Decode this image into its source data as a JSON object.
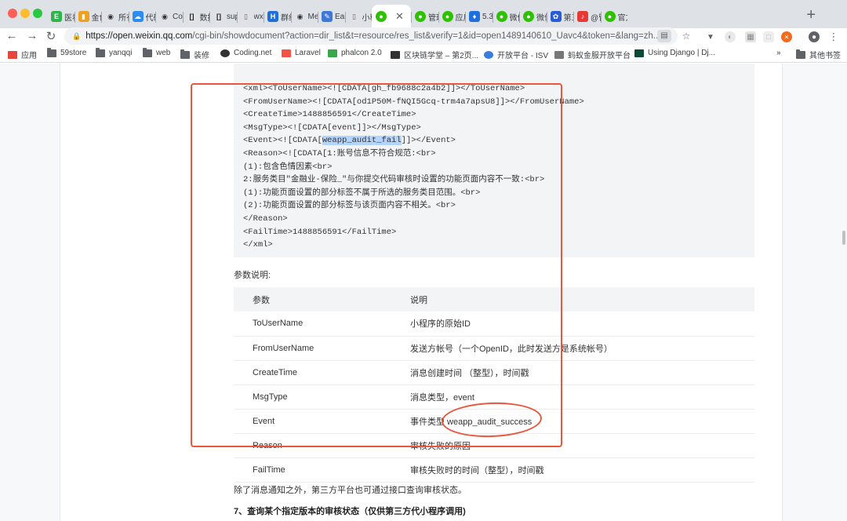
{
  "colors": {
    "close": "#ff5f57",
    "minimize": "#febc2e",
    "zoom": "#28c840",
    "wechat_green": "#2dc100",
    "annotation_red": "#e9573f"
  },
  "tabs": [
    {
      "label": "医看",
      "icon": "doc-icon",
      "color": "#2fb34b"
    },
    {
      "label": "金色",
      "icon": "bars-icon",
      "color": "#f0a020"
    },
    {
      "label": "所有",
      "icon": "github-icon",
      "color": "#333333"
    },
    {
      "label": "代码",
      "icon": "cloud-icon",
      "color": "#2d8cf0"
    },
    {
      "label": "Coc",
      "icon": "github-icon",
      "color": "#333333"
    },
    {
      "label": "数据",
      "icon": "brackets-icon",
      "color": "#222222"
    },
    {
      "label": "sup",
      "icon": "brackets-icon",
      "color": "#222222"
    },
    {
      "label": "wxl",
      "icon": "page-icon",
      "color": "#666666"
    },
    {
      "label": "群组",
      "icon": "h-icon",
      "color": "#1e6fd9"
    },
    {
      "label": "Me",
      "icon": "github-icon",
      "color": "#333333"
    },
    {
      "label": "Eas",
      "icon": "easy-icon",
      "color": "#3c78d8"
    },
    {
      "label": "小程",
      "icon": "page-icon",
      "color": "#666666"
    },
    {
      "label": "",
      "icon": "wechat-icon",
      "color": "#2dc100",
      "active": true
    },
    {
      "label": "管理",
      "icon": "wechat-icon",
      "color": "#2dc100"
    },
    {
      "label": "应用",
      "icon": "wechat-icon",
      "color": "#2dc100"
    },
    {
      "label": "5.3",
      "icon": "flame-icon",
      "color": "#1d6fe0"
    },
    {
      "label": "微信",
      "icon": "wechat-icon",
      "color": "#2dc100"
    },
    {
      "label": "微信",
      "icon": "wechat-icon",
      "color": "#2dc100"
    },
    {
      "label": "第三",
      "icon": "paw-icon",
      "color": "#2a5bd7"
    },
    {
      "label": "@管",
      "icon": "music-icon",
      "color": "#e53935"
    },
    {
      "label": "官方",
      "icon": "wechat-icon",
      "color": "#2dc100"
    }
  ],
  "toolbar": {
    "back": "←",
    "forward": "→",
    "reload": "↻",
    "url_domain": "https://open.weixin.qq.com",
    "url_path": "/cgi-bin/showdocument?action=dir_list&t=resource/res_list&verify=1&id=open1489140610_Uavc4&token=&lang=zh..."
  },
  "bookmarks": [
    {
      "label": "应用",
      "icon": "apps-icon"
    },
    {
      "label": "59store",
      "icon": "folder-icon"
    },
    {
      "label": "yanqqi",
      "icon": "folder-icon"
    },
    {
      "label": "web",
      "icon": "folder-icon"
    },
    {
      "label": "装修",
      "icon": "folder-icon"
    },
    {
      "label": "Coding.net",
      "icon": "github-icon"
    },
    {
      "label": "Laravel",
      "icon": "laravel-icon"
    },
    {
      "label": "phalcon 2.0",
      "icon": "phalcon-icon"
    },
    {
      "label": "区块链学堂 – 第2页...",
      "icon": "block-icon"
    },
    {
      "label": "开放平台 - ISV",
      "icon": "person-icon"
    },
    {
      "label": "蚂蚁金服开放平台",
      "icon": "page-icon"
    },
    {
      "label": "Using Django | Dj...",
      "icon": "django-icon"
    },
    {
      "label": "»",
      "icon": ""
    },
    {
      "label": "其他书签",
      "icon": "folder-icon"
    }
  ],
  "code_lines": [
    {
      "pre": "<xml><ToUserName><![CDATA[gh_fb9688c2a4b2]]></ToUserName>",
      "hl": "",
      "post": ""
    },
    {
      "pre": "<FromUserName><![CDATA[od1P50M-fNQI5Gcq-trm4a7apsU8]]></FromUserName>",
      "hl": "",
      "post": ""
    },
    {
      "pre": "<CreateTime>1488856591</CreateTime>",
      "hl": "",
      "post": ""
    },
    {
      "pre": "<MsgType><![CDATA[event]]></MsgType>",
      "hl": "",
      "post": ""
    },
    {
      "pre": "<Event><![CDATA[",
      "hl": "weapp_audit_fail",
      "post": "]]></Event>"
    },
    {
      "pre": "<Reason><![CDATA[1:账号信息不符合规范:<br>",
      "hl": "",
      "post": ""
    },
    {
      "pre": "(1):包含色情因素<br>",
      "hl": "",
      "post": ""
    },
    {
      "pre": "2:服务类目\"金融业-保险_\"与你提交代码审核时设置的功能页面内容不一致:<br>",
      "hl": "",
      "post": ""
    },
    {
      "pre": "(1):功能页面设置的部分标签不属于所选的服务类目范围。<br>",
      "hl": "",
      "post": ""
    },
    {
      "pre": "(2):功能页面设置的部分标签与该页面内容不相关。<br>",
      "hl": "",
      "post": ""
    },
    {
      "pre": "</Reason>",
      "hl": "",
      "post": ""
    },
    {
      "pre": "<FailTime>1488856591</FailTime>",
      "hl": "",
      "post": ""
    },
    {
      "pre": "</xml>",
      "hl": "",
      "post": ""
    }
  ],
  "params_title": "参数说明:",
  "table": {
    "headers": [
      "参数",
      "说明"
    ],
    "rows": [
      [
        "ToUserName",
        "小程序的原始ID"
      ],
      [
        "FromUserName",
        "发送方帐号（一个OpenID，此时发送方是系统帐号）"
      ],
      [
        "CreateTime",
        "消息创建时间 （整型），时间戳"
      ],
      [
        "MsgType",
        "消息类型，event"
      ],
      [
        "Event",
        "事件类型 weapp_audit_success"
      ],
      [
        "Reason",
        "审核失败的原因"
      ],
      [
        "FailTime",
        "审核失败时的时间（整型），时间戳"
      ]
    ]
  },
  "footer_text": "除了消息通知之外，第三方平台也可通过接口查询审核状态。",
  "section_heading": "7、查询某个指定版本的审核状态（仅供第三方代小程序调用)"
}
